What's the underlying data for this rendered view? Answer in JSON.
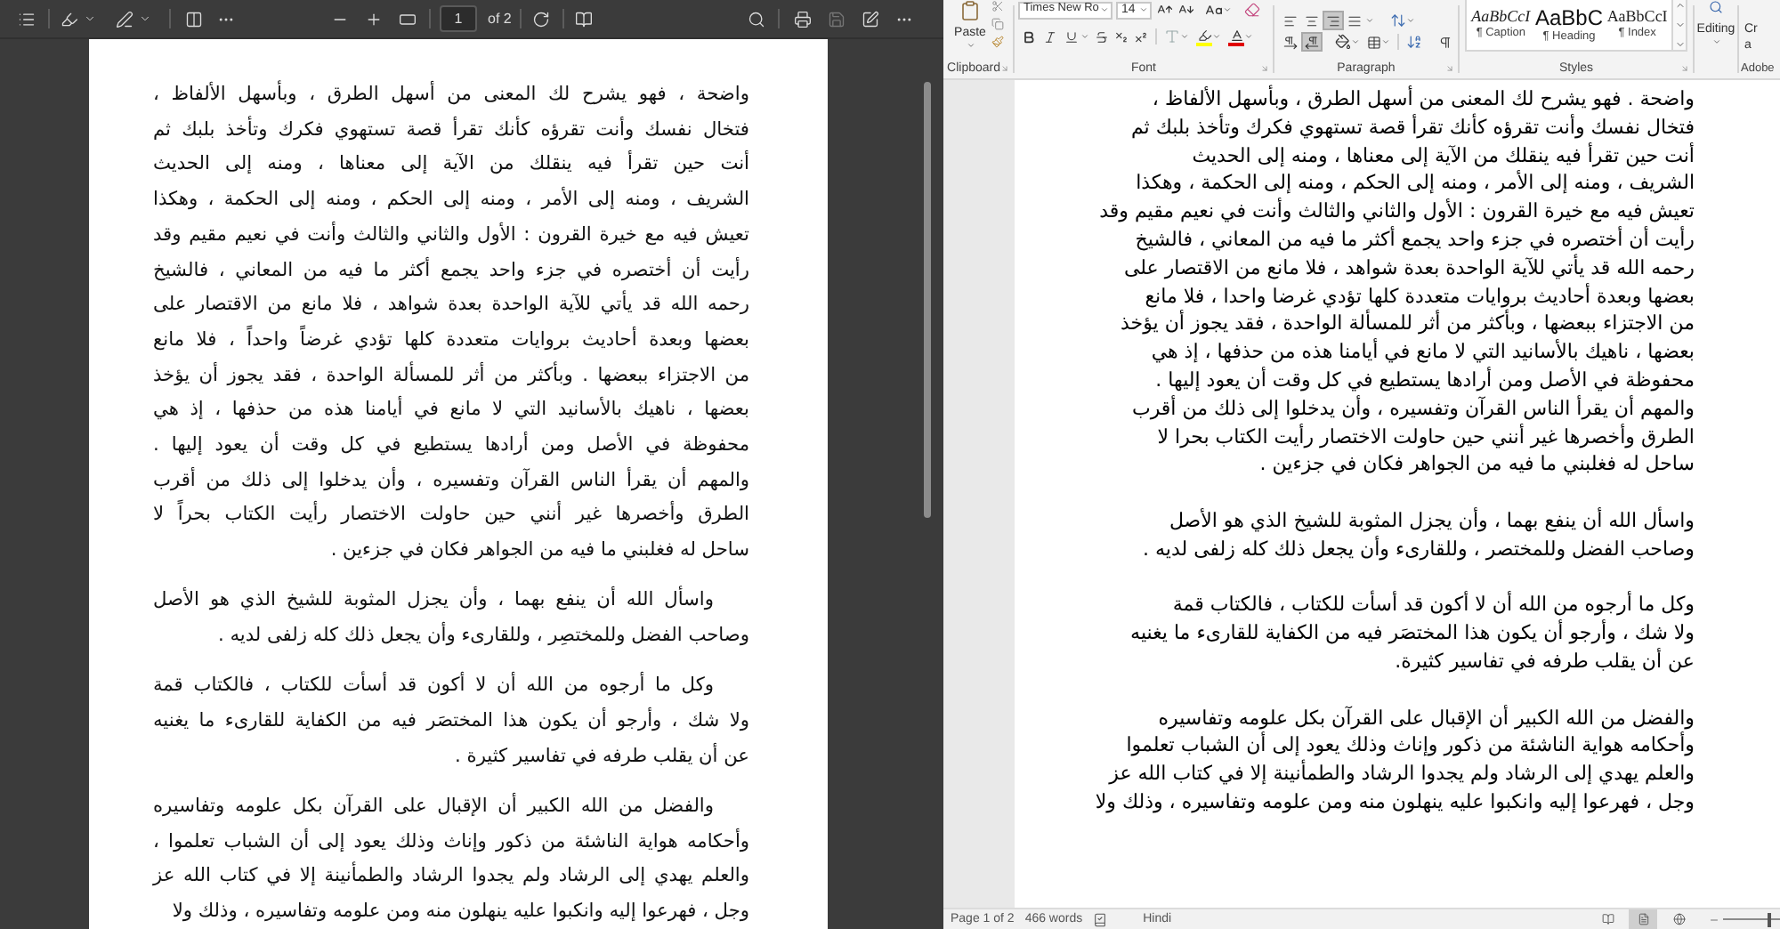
{
  "pdf_viewer": {
    "toolbar": {
      "page_number": "1",
      "page_count": "of 2",
      "save_disabled": true
    },
    "page": {
      "paragraphs": [
        {
          "kind": "continuation",
          "lines": [
            "واضحة ، فهو يشرح لك المعنى من أسهل الطرق ، وبأسهل الألفاظ ،",
            "فتخال نفسك وأنت تقرؤه كأنك تقرأ قصة تستهوي فكرك وتأخذ بلبك ثم",
            "أنت حين تقرأ فيه ينقلك من الآية إلى معناها ، ومنه إلى الحديث",
            "الشريف ، ومنه إلى الأمر ، ومنه إلى الحكم ، ومنه إلى الحكمة ، وهكذا",
            "تعيش فيه مع خيرة القرون : الأول والثاني والثالث وأنت في نعيم مقيم وقد",
            "رأيت أن أختصره في جزء واحد يجمع أكثر ما فيه من المعاني ، فالشيخ",
            "رحمه الله قد يأتي للآية الواحدة بعدة شواهد ، فلا مانع من الاقتصار على",
            "بعضها وبعدة أحاديث بروايات متعددة كلها تؤدي غرضاً واحداً ، فلا مانع",
            "من الاجتزاء ببعضها . وبأكثر من أثر للمسألة الواحدة ، فقد يجوز أن يؤخذ",
            "بعضها ، ناهيك بالأسانيد التي لا مانع في أيامنا هذه من حذفها ، إذ هي",
            "محفوظة في الأصل ومن أرادها يستطيع في كل وقت أن يعود إليها .",
            "والمهم أن يقرأ الناس القرآن وتفسيره ، وأن يدخلوا إلى ذلك من أقرب",
            "الطرق وأخصرها غير أنني حين حاولت الاختصار رأيت الكتاب بحراً لا",
            "ساحل له فغلبني ما فيه من الجواهر فكان في جزءين ."
          ]
        },
        {
          "kind": "indented",
          "lines": [
            "واسأل الله أن ينفع بهما ، وأن يجزل المثوبة للشيخ الذي هو الأصل",
            "وصاحب الفضل وللمختصِر ، وللقارىء وأن يجعل ذلك كله زلفى لديه ."
          ]
        },
        {
          "kind": "indented",
          "lines": [
            "وكل ما أرجوه من الله أن لا أكون قد أسأت للكتاب ، فالكتاب قمة",
            "ولا شك ، وأرجو أن يكون هذا المختصَر فيه من الكفاية للقارىء ما يغنيه",
            "عن أن يقلب طرفه في تفاسير كثيرة ."
          ]
        },
        {
          "kind": "indented",
          "lines": [
            "والفضل من الله الكبير أن الإقبال على القرآن بكل علومه وتفاسيره",
            "وأحكامه هواية الناشئة من ذكور وإناث وذلك يعود إلى أن الشباب تعلموا ،",
            "والعلم يهدي إلى الرشاد ولم يجدوا الرشاد والطمأنينة إلا في كتاب الله عز",
            "وجل ، فهرعوا إليه وانكبوا عليه ينهلون منه ومن علومه وتفاسيره ، وذلك ولا"
          ]
        }
      ]
    }
  },
  "word": {
    "ribbon": {
      "clipboard": {
        "paste": "Paste",
        "label": "Clipboard"
      },
      "font": {
        "name": "Times New Ro",
        "size": "14",
        "label": "Font"
      },
      "paragraph": {
        "align_buttons": [
          {
            "selected": false
          },
          {
            "selected": false
          },
          {
            "selected": true
          },
          {
            "selected": false
          }
        ],
        "direction_buttons": [
          {
            "selected": false
          },
          {
            "selected": true
          }
        ],
        "label": "Paragraph"
      },
      "styles": {
        "caption_style": {
          "sample": "AaBbCcI",
          "name": "¶ Caption"
        },
        "heading_style": {
          "sample": "AaBbC",
          "name": "¶ Heading"
        },
        "index_style": {
          "sample": "AaBbCcI",
          "name": "¶ Index"
        },
        "label": "Styles"
      },
      "editing": {
        "label": "Editing"
      },
      "adobe": {
        "button_lines": [
          "Cr",
          "a"
        ],
        "label": "Adobe"
      }
    },
    "document": {
      "paragraphs": [
        {
          "lines": [
            "واضحة . فهو يشرح لك المعنى من أسهل الطرق ، وبأسهل الألفاظ ،",
            "فتخال نفسك وأنت تقرؤه كأنك تقرأ قصة تستهوي فكرك وتأخذ بلبك ثم",
            "أنت حين تقرأ فيه ينقلك من الآية إلى معناها ، ومنه إلى الحديث",
            "الشريف ، ومنه إلى الأمر ، ومنه إلى الحكم ، ومنه إلى الحكمة ، وهكذا",
            "تعيش فيه مع خيرة القرون : الأول والثاني والثالث وأنت في نعيم مقيم وقد",
            "رأيت أن أختصره في جزء واحد يجمع أكثر ما فيه من المعاني ، فالشيخ",
            "رحمه الله قد يأتي للآية الواحدة بعدة شواهد ، فلا مانع من الاقتصار على",
            "بعضها وبعدة أحاديث بروايات متعددة كلها تؤدي غرضا واحدا ، فلا مانع",
            "من الاجتزاء ببعضها ، وبأكثر من أثر للمسألة الواحدة ، فقد يجوز أن يؤخذ",
            "بعضها ، ناهيك بالأسانيد التي لا مانع في أيامنا هذه من حذفها ، إذ هي",
            "محفوظة في الأصل ومن أرادها يستطيع في كل وقت أن يعود إليها .",
            "والمهم أن يقرأ الناس القرآن وتفسيره ، وأن يدخلوا إلى ذلك من أقرب",
            "الطرق وأخصرها غير أنني حين حاولت الاختصار رأيت الكتاب بحرا لا",
            "ساحل له فغلبني ما فيه من الجواهر فكان في جزءين ."
          ]
        },
        {
          "lines": [
            "واسأل الله أن ينفع بهما ، وأن يجزل المثوبة للشيخ الذي هو الأصل",
            "وصاحب الفضل وللمختصر ، وللقارىء وأن يجعل ذلك كله زلفى لديه ."
          ]
        },
        {
          "lines": [
            "وكل ما أرجوه من الله أن لا أكون قد أسأت للكتاب ، فالكتاب قمة",
            "ولا شك ، وأرجو أن يكون هذا المختصَر فيه من الكفاية للقارىء ما يغنيه",
            "عن أن يقلب طرفه في تفاسير كثيرة."
          ]
        },
        {
          "lines": [
            "والفضل من الله الكبير أن الإقبال على القرآن بكل علومه وتفاسيره",
            "وأحكامه هواية الناشئة من ذكور وإناث وذلك يعود إلى أن الشباب تعلموا",
            "والعلم يهدي إلى الرشاد ولم يجدوا الرشاد والطمأنينة إلا في كتاب الله عز",
            "وجل ، فهرعوا إليه وانكبوا عليه ينهلون منه ومن علومه وتفاسيره ، وذلك ولا"
          ]
        }
      ]
    },
    "status_bar": {
      "page": "Page 1 of 2",
      "words": "466 words",
      "language": "Hindi",
      "views": [
        {
          "selected": false
        },
        {
          "selected": true
        },
        {
          "selected": false
        }
      ],
      "zoom": {
        "level": 0.8
      }
    }
  }
}
